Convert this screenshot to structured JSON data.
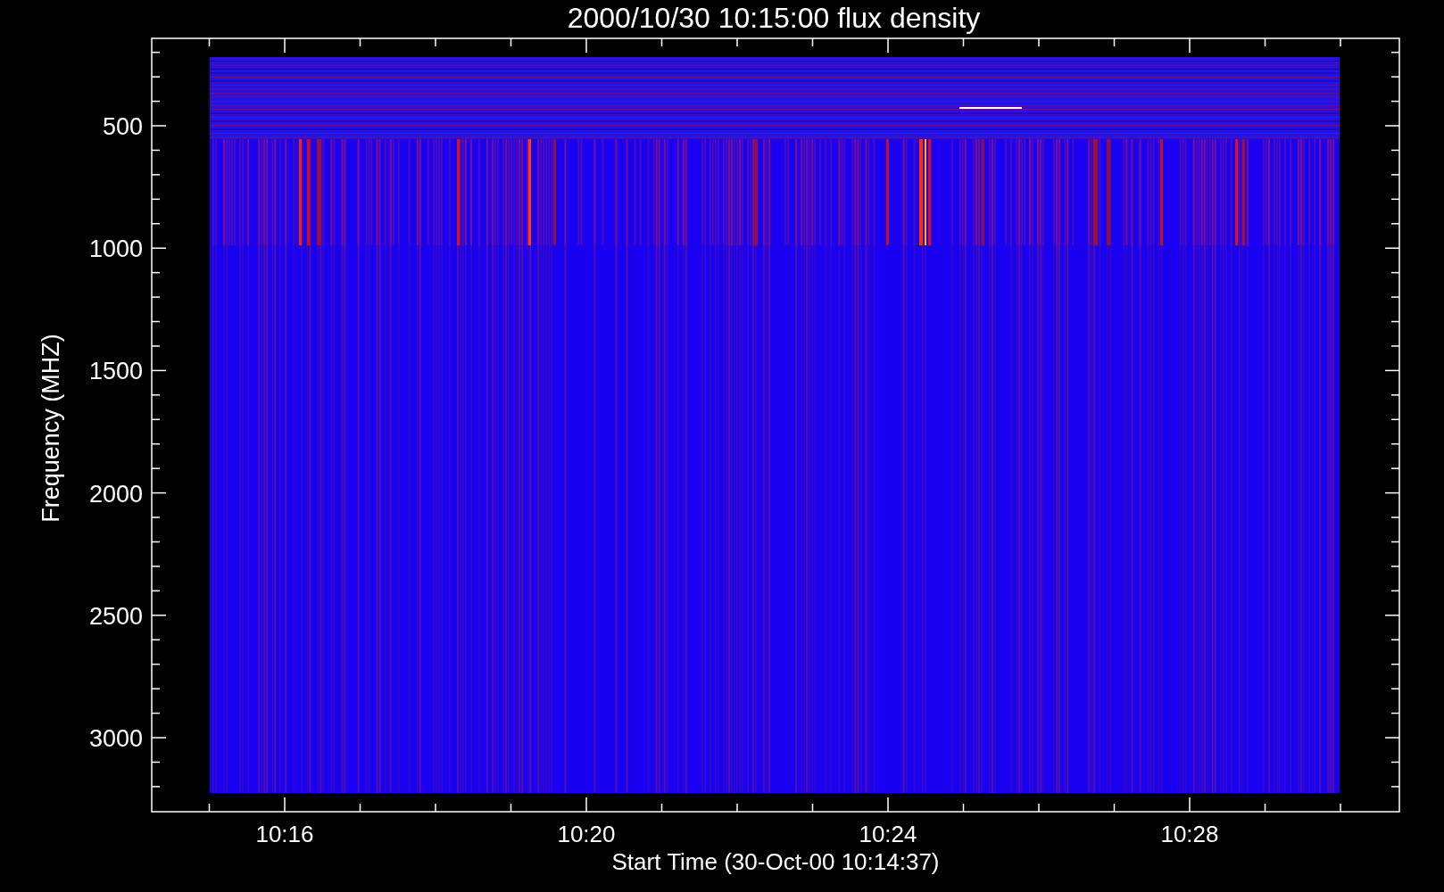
{
  "title": "2000/10/30 10:15:00 flux density",
  "y_axis": {
    "label": "Frequency (MHZ)",
    "ticks": [
      "500",
      "1000",
      "1500",
      "2000",
      "2500",
      "3000"
    ]
  },
  "x_axis": {
    "label": "Start Time (30-Oct-00 10:14:37)",
    "ticks": [
      "10:16",
      "10:20",
      "10:24",
      "10:28"
    ]
  }
}
